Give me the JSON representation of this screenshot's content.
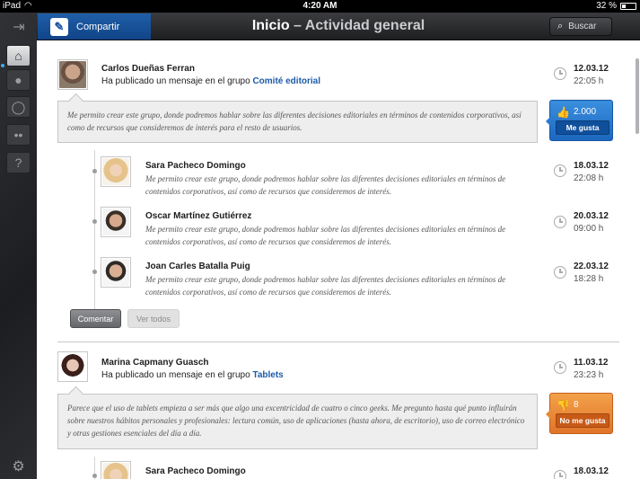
{
  "status_bar": {
    "carrier": "iPad",
    "time": "4:20 AM",
    "battery": "32 %"
  },
  "rail": {
    "items": [
      {
        "name": "home",
        "icon": "home-icon",
        "active": true
      },
      {
        "name": "profile",
        "icon": "person-icon",
        "active": false
      },
      {
        "name": "activity",
        "icon": "refresh-icon",
        "active": false
      },
      {
        "name": "groups",
        "icon": "group-icon",
        "active": false
      },
      {
        "name": "help",
        "icon": "help-icon",
        "active": false
      }
    ]
  },
  "header": {
    "share_label": "Compartir",
    "title_main": "Inicio",
    "title_sep": " – ",
    "title_sub": "Actividad general",
    "search_label": "Buscar"
  },
  "posts": [
    {
      "author": "Carlos Dueñas Ferran",
      "posted_prefix": "Ha publicado un mensaje en el grupo ",
      "group": "Comité editorial",
      "date": "12.03.12",
      "time": "22:05 h",
      "message": "Me permito crear este grupo, donde podremos hablar sobre las diferentes decisiones editoriales en términos de contenidos corporativos, así como de recursos que consideremos de interés para el resto de usuarios.",
      "reaction_count": "2.000",
      "reaction_button": "Me gusta",
      "reaction_color": "#1c67bf",
      "replies": [
        {
          "author": "Sara Pacheco Domingo",
          "text": "Me permito crear este grupo, donde podremos hablar sobre las diferentes decisiones editoriales en términos de contenidos corporativos, así como de recursos que consideremos de interés.",
          "date": "18.03.12",
          "time": "22:08 h"
        },
        {
          "author": "Oscar Martínez Gutiérrez",
          "text": "Me permito crear este grupo, donde podremos hablar sobre las diferentes decisiones editoriales en términos de contenidos corporativos, así como de recursos que consideremos de interés.",
          "date": "20.03.12",
          "time": "09:00 h"
        },
        {
          "author": "Joan Carles Batalla Puig",
          "text": "Me permito crear este grupo, donde podremos hablar sobre las diferentes decisiones editoriales en términos de contenidos corporativos, así como de recursos que consideremos de interés.",
          "date": "22.03.12",
          "time": "18:28 h"
        }
      ],
      "comment_label": "Comentar",
      "view_all_label": "Ver todos"
    },
    {
      "author": "Marina Capmany Guasch",
      "posted_prefix": "Ha publicado un mensaje en el grupo ",
      "group": "Tablets",
      "date": "11.03.12",
      "time": "23:23 h",
      "message": "Parece que el uso de tablets empieza a ser más que algo una excentricidad de cuatro o cinco geeks. Me pregunto hasta qué punto influirán sobre nuestros hábitos personales y profesionales: lectura común, uso de aplicaciones (hasta ahora, de escritorio), uso de correo electrónico y otras gestiones esenciales del día a día.",
      "reaction_count": "8",
      "reaction_button": "No me gusta",
      "reaction_color": "#e0752a",
      "replies": [
        {
          "author": "Sara Pacheco Domingo",
          "date": "18.03.12"
        }
      ]
    }
  ]
}
